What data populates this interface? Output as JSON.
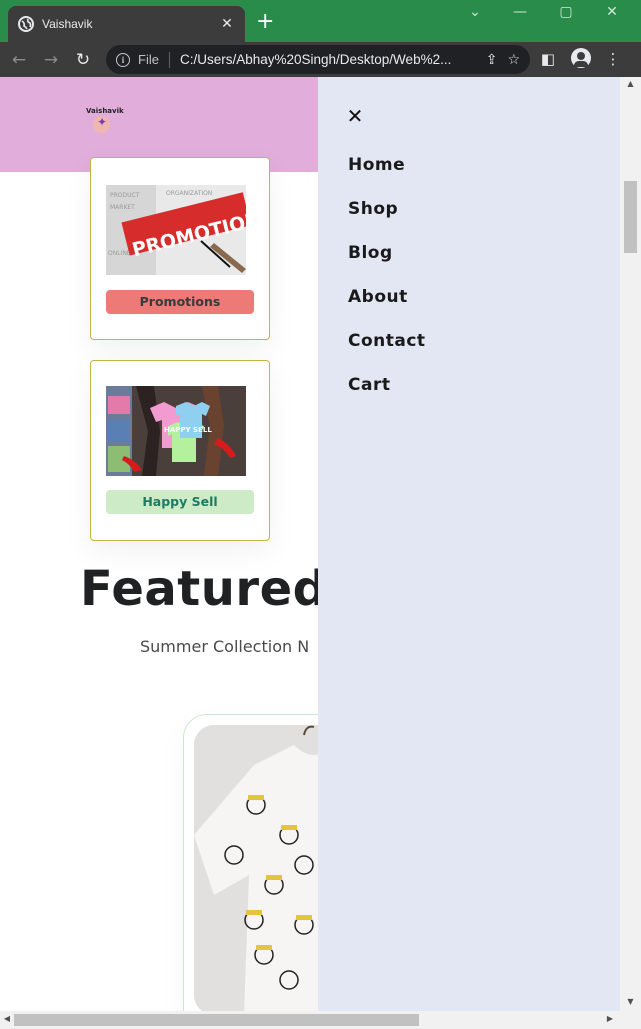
{
  "browser": {
    "tab_title": "Vaishavik",
    "new_tab_symbol": "+",
    "scheme_label": "File",
    "url": "C:/Users/Abhay%20Singh/Desktop/Web%2...",
    "icons": [
      "globe-icon",
      "close-icon",
      "back-icon",
      "forward-icon",
      "reload-icon",
      "info-icon",
      "share-icon",
      "star-icon",
      "side-panel-icon",
      "profile-icon",
      "menu-icon",
      "minimize-icon",
      "maximize-icon"
    ]
  },
  "site": {
    "logo_text": "Vaishavik",
    "header_color": "#e1aedc",
    "banners": [
      {
        "image_text": "PROMOTION",
        "button_label": "Promotions",
        "button_color": "#ee7a78"
      },
      {
        "image_text": "HAPPY SELL",
        "button_label": "Happy Sell",
        "button_color": "#cdebc7"
      }
    ],
    "featured_title": "Featured",
    "featured_subtitle": "Summer Collection N"
  },
  "nav_menu": {
    "background": "#e3e6f3",
    "close_symbol": "✕",
    "items": [
      "Home",
      "Shop",
      "Blog",
      "About",
      "Contact",
      "Cart"
    ]
  }
}
